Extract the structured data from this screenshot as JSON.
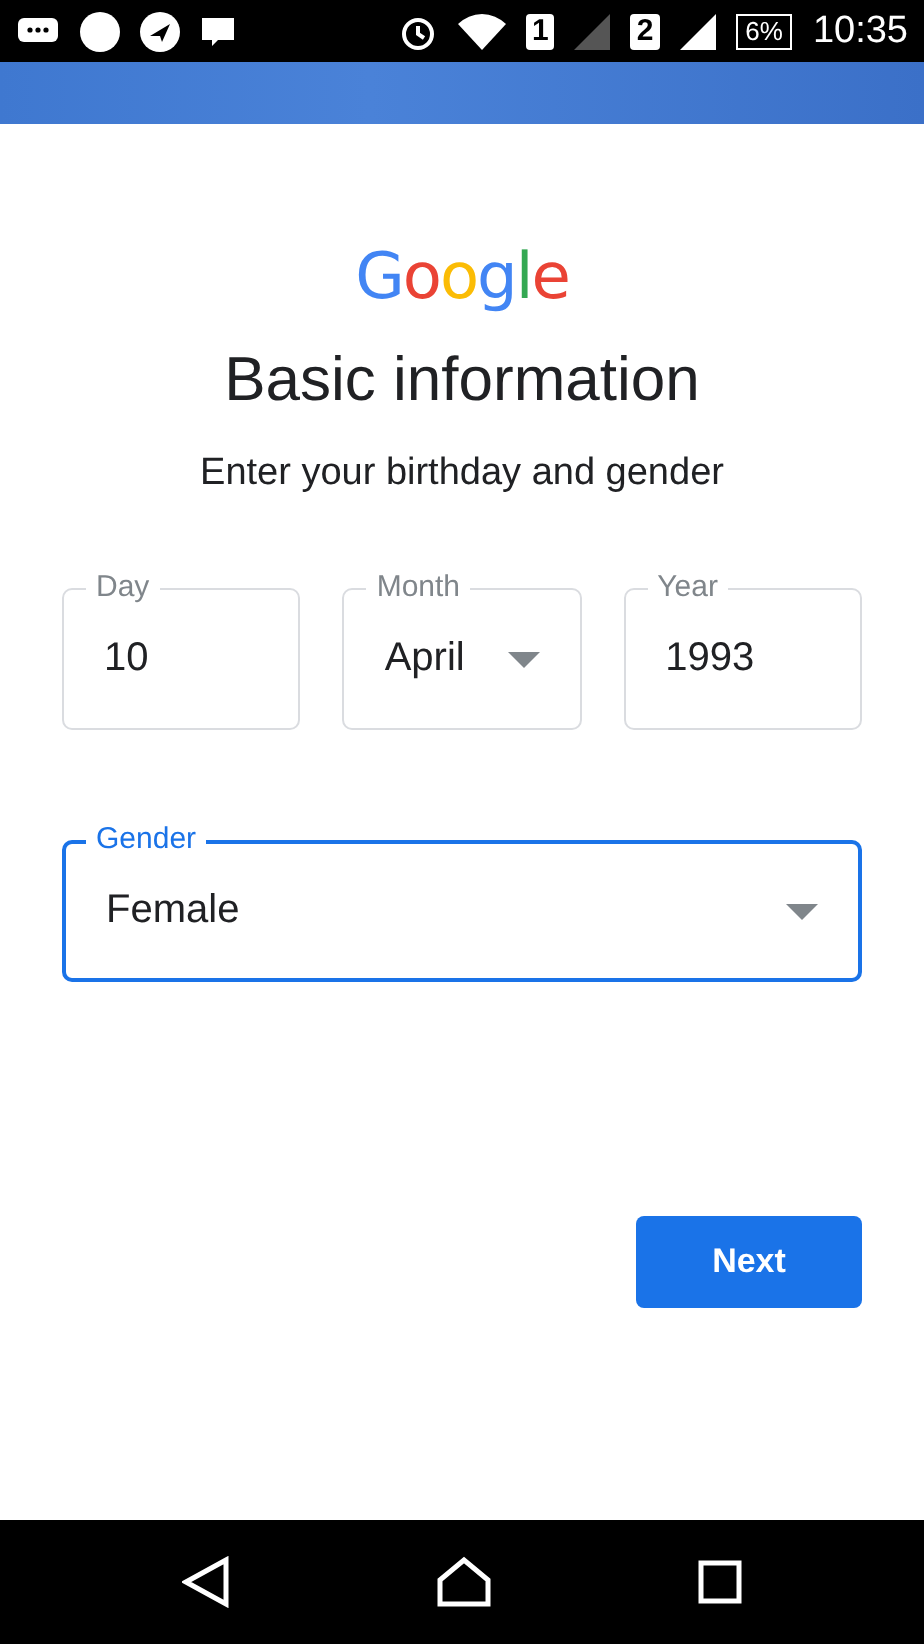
{
  "status_bar": {
    "sim_1": "1",
    "sim_2": "2",
    "battery": "6%",
    "time": "10:35"
  },
  "logo": "Google",
  "title": "Basic information",
  "subtitle": "Enter your birthday and gender",
  "birthday_fields": [
    {
      "kind": "text",
      "label": "Day",
      "value": "10",
      "focused": false
    },
    {
      "kind": "select",
      "label": "Month",
      "value": "April",
      "focused": false
    },
    {
      "kind": "text",
      "label": "Year",
      "value": "1993",
      "focused": false
    }
  ],
  "gender_field": {
    "kind": "select",
    "label": "Gender",
    "value": "Female",
    "focused": true
  },
  "next_button": "Next"
}
